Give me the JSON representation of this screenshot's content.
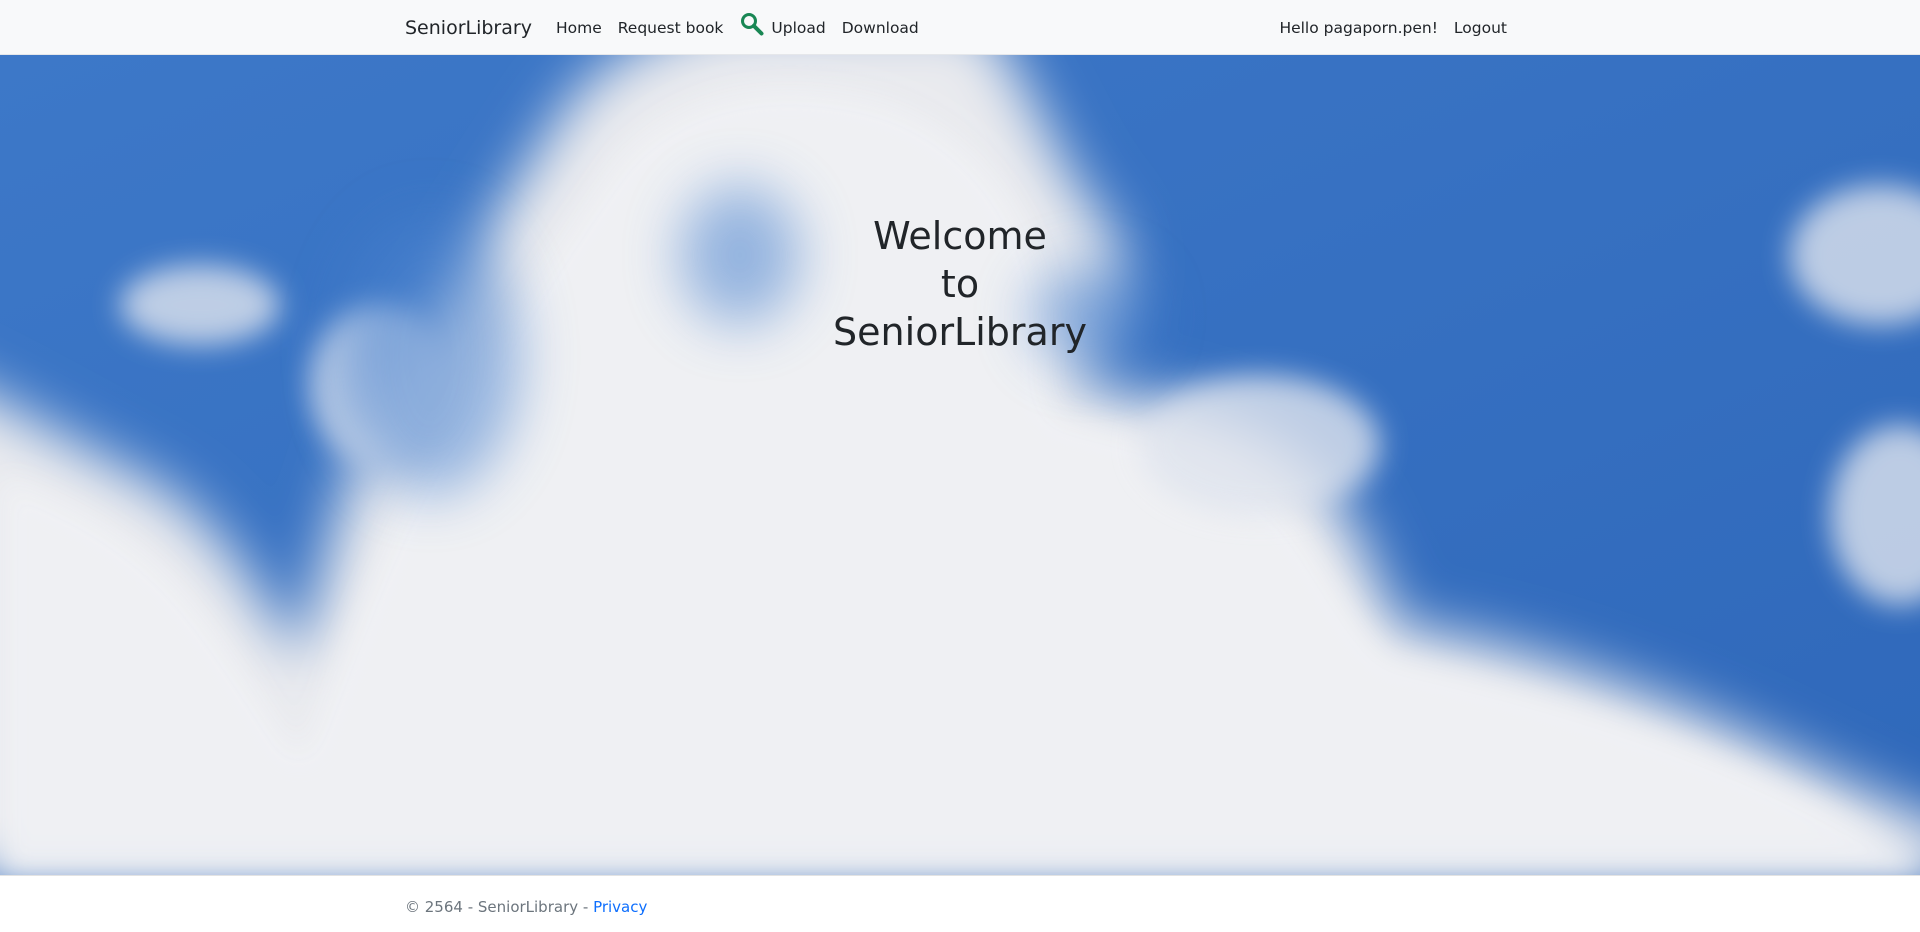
{
  "navbar": {
    "brand": "SeniorLibrary",
    "links": {
      "home": "Home",
      "request_book": "Request book",
      "upload": "Upload",
      "download": "Download"
    },
    "search_icon": "search-icon",
    "greeting": "Hello pagaporn.pen!",
    "logout": "Logout"
  },
  "hero": {
    "line1": "Welcome",
    "line2": "to",
    "line3": "SeniorLibrary"
  },
  "footer": {
    "copyright": "© 2564 - SeniorLibrary - ",
    "privacy": "Privacy"
  },
  "colors": {
    "navbar_bg": "#f8f9fa",
    "sky_blue": "#3a73c4",
    "cloud": "#e8e9ed",
    "search_icon": "#198754",
    "link": "#0d6efd",
    "text": "#212529",
    "muted": "#6c757d"
  }
}
